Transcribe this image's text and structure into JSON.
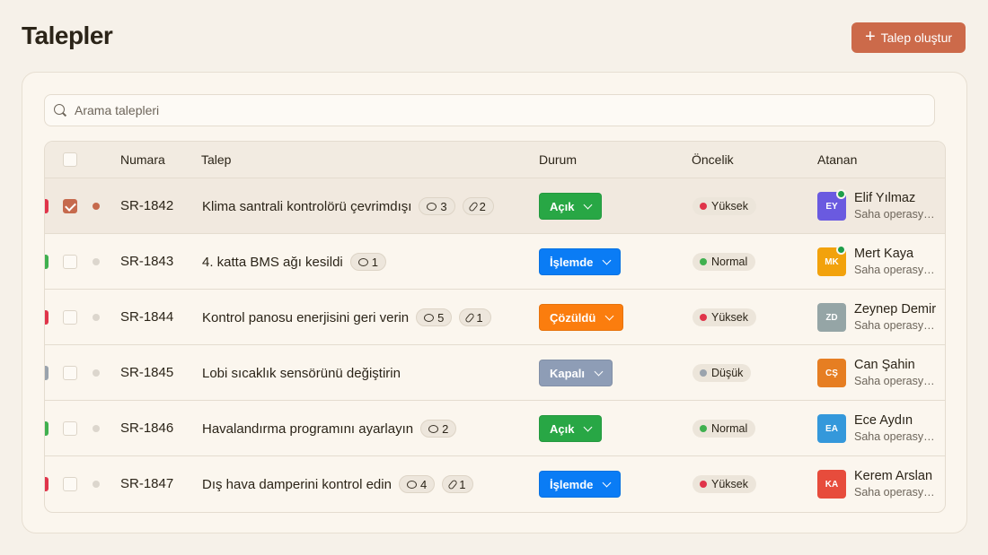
{
  "page": {
    "title": "Talepler"
  },
  "toolbar": {
    "create_label": "Talep oluştur",
    "create_icon": "plus-icon"
  },
  "search": {
    "placeholder": "Arama talepleri",
    "value": ""
  },
  "table": {
    "columns": {
      "number": "Numara",
      "request": "Talep",
      "status": "Durum",
      "priority": "Öncelik",
      "assignee": "Atanan"
    },
    "rows": [
      {
        "number": "SR-1842",
        "title": "Klima santrali kontrolörü çevrimdışı",
        "comments": "3",
        "attachments": "2",
        "status": "Açık",
        "status_color": "#28a745",
        "priority": "Yüksek",
        "priority_color": "#e0344a",
        "selected": true,
        "unread": true,
        "assignee_initials": "EY",
        "assignee_name": "Elif Yılmaz",
        "assignee_team": "Saha operasyonları",
        "avatar_color": "#6a5ae0",
        "online": true
      },
      {
        "number": "SR-1843",
        "title": "4. katta BMS ağı kesildi",
        "comments": "1",
        "attachments": "",
        "status": "İşlemde",
        "status_color": "#0a7cf5",
        "priority": "Normal",
        "priority_color": "#3fb04f",
        "selected": false,
        "unread": false,
        "assignee_initials": "MK",
        "assignee_name": "Mert Kaya",
        "assignee_team": "Saha operasyonları",
        "avatar_color": "#f2a20c",
        "online": true
      },
      {
        "number": "SR-1844",
        "title": "Kontrol panosu enerjisini geri verin",
        "comments": "5",
        "attachments": "1",
        "status": "Çözüldü",
        "status_color": "#fb7d0e",
        "priority": "Yüksek",
        "priority_color": "#e0344a",
        "selected": false,
        "unread": false,
        "assignee_initials": "ZD",
        "assignee_name": "Zeynep Demir",
        "assignee_team": "Saha operasyonları",
        "avatar_color": "#95a5a6",
        "online": false
      },
      {
        "number": "SR-1845",
        "title": "Lobi sıcaklık sensörünü değiştirin",
        "comments": "",
        "attachments": "",
        "status": "Kapalı",
        "status_color": "#8e9db6",
        "priority": "Düşük",
        "priority_color": "#9aa3ad",
        "selected": false,
        "unread": false,
        "assignee_initials": "CŞ",
        "assignee_name": "Can Şahin",
        "assignee_team": "Saha operasyonları",
        "avatar_color": "#e67e22",
        "online": false
      },
      {
        "number": "SR-1846",
        "title": "Havalandırma programını ayarlayın",
        "comments": "2",
        "attachments": "",
        "status": "Açık",
        "status_color": "#28a745",
        "priority": "Normal",
        "priority_color": "#3fb04f",
        "selected": false,
        "unread": false,
        "assignee_initials": "EA",
        "assignee_name": "Ece Aydın",
        "assignee_team": "Saha operasyonları",
        "avatar_color": "#3498db",
        "online": false
      },
      {
        "number": "SR-1847",
        "title": "Dış hava damperini kontrol edin",
        "comments": "4",
        "attachments": "1",
        "status": "İşlemde",
        "status_color": "#0a7cf5",
        "priority": "Yüksek",
        "priority_color": "#e0344a",
        "selected": false,
        "unread": false,
        "assignee_initials": "KA",
        "assignee_name": "Kerem Arslan",
        "assignee_team": "Saha operasyonları",
        "avatar_color": "#e74c3c",
        "online": false
      }
    ]
  }
}
